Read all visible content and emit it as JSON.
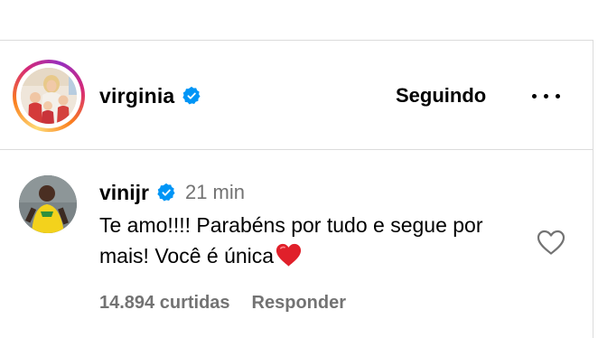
{
  "colors": {
    "divider": "#dbdbdb",
    "muted_text": "#737373",
    "verified_blue": "#0095f6",
    "heart_red": "#e0202a"
  },
  "post": {
    "owner": {
      "username": "virginia",
      "verified": true,
      "avatar_icon": "profile-photo",
      "story_ring": true
    },
    "follow_label": "Seguindo",
    "more_icon": "more-options-icon"
  },
  "comment": {
    "username": "vinijr",
    "verified": true,
    "time": "21 min",
    "text": "Te amo!!!! Parabéns por tudo e segue por mais! Você é única",
    "emoji": "red-heart",
    "likes": "14.894 curtidas",
    "reply_label": "Responder",
    "like_icon": "heart-outline-icon"
  }
}
